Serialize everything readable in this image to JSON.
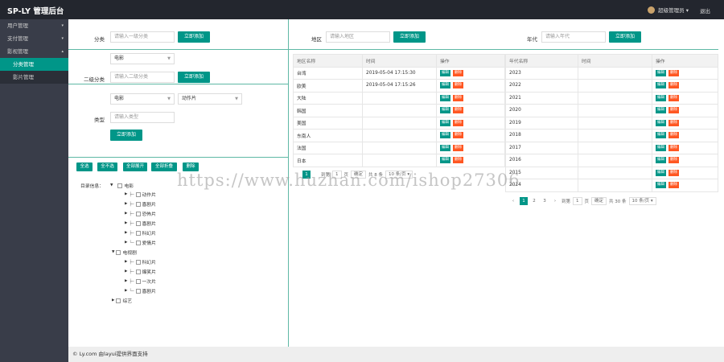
{
  "header": {
    "logo": "SP-LY 管理后台",
    "user": "超级管理员 ▾",
    "logout": "退出"
  },
  "sidebar": {
    "items": [
      {
        "label": "用户管理",
        "arrow": "▾"
      },
      {
        "label": "支付管理",
        "arrow": "▾"
      },
      {
        "label": "影视管理",
        "arrow": "▴"
      }
    ],
    "subitems": [
      "分类管理",
      "影片管理"
    ]
  },
  "category_panel": {
    "cat1": {
      "label": "分类",
      "placeholder": "请输入一级分类",
      "button": "立即添加"
    },
    "cat2": {
      "select": "电影",
      "label": "二级分类",
      "placeholder": "请输入二级分类",
      "button": "立即添加"
    },
    "cat3": {
      "select1": "电影",
      "select2": "动作片",
      "label": "类型",
      "placeholder": "请输入类型",
      "button": "立即添加"
    }
  },
  "region_panel": {
    "label": "地区",
    "placeholder": "请输入地区",
    "button": "立即添加",
    "columns": [
      "地区名称",
      "时间",
      "操作"
    ],
    "rows": [
      {
        "name": "台湾",
        "time": "2019-05-04 17:15:30"
      },
      {
        "name": "欧美",
        "time": "2019-05-04 17:15:26"
      },
      {
        "name": "大陆",
        "time": ""
      },
      {
        "name": "韩国",
        "time": ""
      },
      {
        "name": "美国",
        "time": ""
      },
      {
        "name": "东南人",
        "time": ""
      },
      {
        "name": "法国",
        "time": ""
      },
      {
        "name": "日本",
        "time": ""
      }
    ],
    "edit": "编辑",
    "delete": "删除",
    "pager": {
      "cur": "1",
      "goto": "到第",
      "page": "1",
      "ye": "页",
      "ok": "确定",
      "total": "共 8 条",
      "size": "10 条/页 ▾"
    }
  },
  "year_panel": {
    "label": "年代",
    "placeholder": "请输入年代",
    "button": "立即添加",
    "columns": [
      "年代名称",
      "时间",
      "操作"
    ],
    "rows": [
      "2023",
      "2022",
      "2021",
      "2020",
      "2019",
      "2018",
      "2017",
      "2016",
      "2015",
      "2014"
    ],
    "edit": "编辑",
    "delete": "删除",
    "pager": {
      "prev": "‹",
      "p1": "1",
      "p2": "2",
      "p3": "3",
      "next": "›",
      "goto": "到第",
      "page": "1",
      "ye": "页",
      "ok": "确定",
      "total": "共 30 条",
      "size": "10 条/页 ▾"
    }
  },
  "tree_panel": {
    "buttons": [
      "全选",
      "全不选",
      "全部展开",
      "全部折叠",
      "删除"
    ],
    "title": "目录信息：",
    "movie": "电影",
    "movie_children": [
      "动作片",
      "喜剧片",
      "恐怖片",
      "喜剧片",
      "科幻片",
      "爱情片"
    ],
    "tv": "电视剧",
    "tv_children": [
      "科幻片",
      "爆笑片",
      "一次片",
      "喜剧片"
    ],
    "variety": "综艺"
  },
  "watermark": "https://www.huzhan.com/ishop27306",
  "footer": "© Ly.com 由layui提供界面支持",
  "colors": {
    "accent": "#009688",
    "danger": "#ff5722",
    "sidebar": "#393d49",
    "topbar": "#23262e"
  }
}
